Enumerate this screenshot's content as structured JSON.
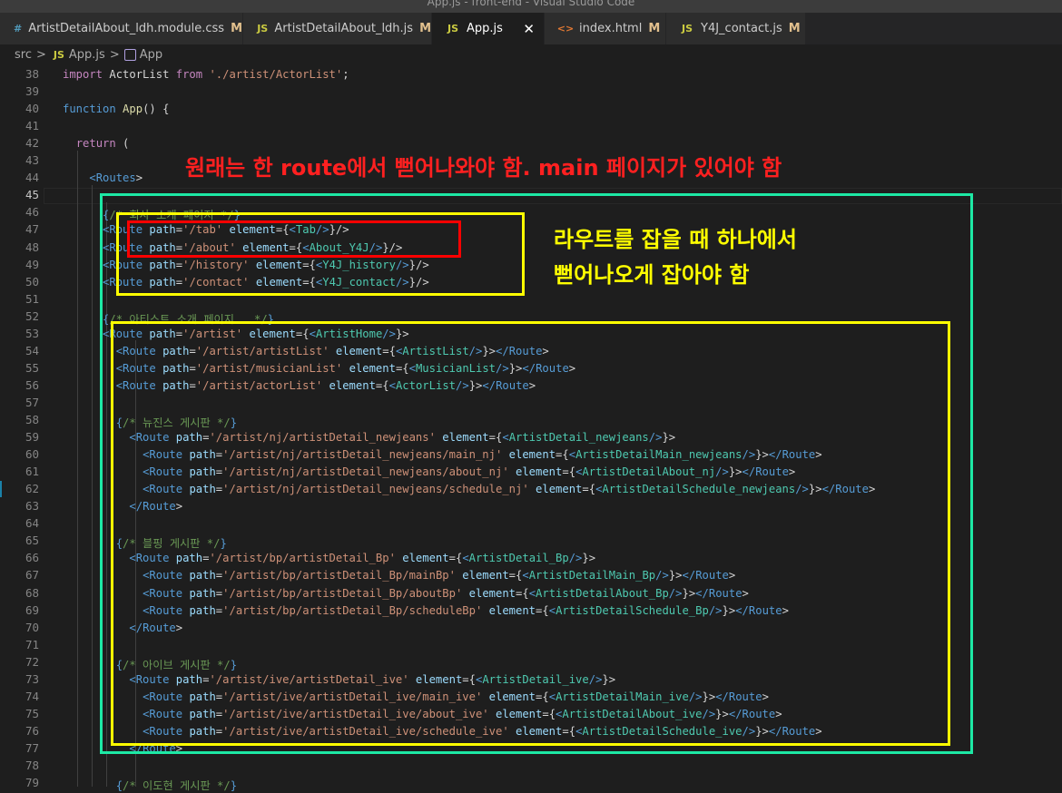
{
  "window": {
    "title": "App.js - front-end - Visual Studio Code"
  },
  "tabs": [
    {
      "icon": "#",
      "label": "ArtistDetailAbout_ldh.module.css",
      "status": "M",
      "active": false
    },
    {
      "icon": "JS",
      "label": "ArtistDetailAbout_ldh.js",
      "status": "M",
      "active": false
    },
    {
      "icon": "JS",
      "label": "App.js",
      "status": "",
      "active": true,
      "close": "✕"
    },
    {
      "icon": "<>",
      "label": "index.html",
      "status": "M",
      "active": false
    },
    {
      "icon": "JS",
      "label": "Y4J_contact.js",
      "status": "M",
      "active": false
    }
  ],
  "breadcrumb": {
    "folder": "src",
    "sep": ">",
    "file_icon": "JS",
    "file": "App.js",
    "symbol": "App"
  },
  "code_lines": [
    {
      "n": "38",
      "text": "import ActorList from './artist/ActorList';"
    },
    {
      "n": "39",
      "text": ""
    },
    {
      "n": "40",
      "text": "function App() {"
    },
    {
      "n": "41",
      "text": ""
    },
    {
      "n": "42",
      "text": "  return ("
    },
    {
      "n": "43",
      "text": ""
    },
    {
      "n": "44",
      "text": "    <Routes>"
    },
    {
      "n": "45",
      "text": ""
    },
    {
      "n": "46",
      "text": "      {/* 회사 소개 페이지 */}"
    },
    {
      "n": "47",
      "text": "      <Route path='/tab' element={<Tab/>}/>"
    },
    {
      "n": "48",
      "text": "      <Route path='/about' element={<About_Y4J/>}/>"
    },
    {
      "n": "49",
      "text": "      <Route path='/history' element={<Y4J_history/>}/>"
    },
    {
      "n": "50",
      "text": "      <Route path='/contact' element={<Y4J_contact/>}/>"
    },
    {
      "n": "51",
      "text": ""
    },
    {
      "n": "52",
      "text": "      {/* 아티스트 소개 페이지   */}"
    },
    {
      "n": "53",
      "text": "      <Route path='/artist' element={<ArtistHome/>}>"
    },
    {
      "n": "54",
      "text": "        <Route path='/artist/artistList' element={<ArtistList/>}></Route>"
    },
    {
      "n": "55",
      "text": "        <Route path='/artist/musicianList' element={<MusicianList/>}></Route>"
    },
    {
      "n": "56",
      "text": "        <Route path='/artist/actorList' element={<ActorList/>}></Route>"
    },
    {
      "n": "57",
      "text": ""
    },
    {
      "n": "58",
      "text": "        {/* 뉴진스 게시판 */}"
    },
    {
      "n": "59",
      "text": "          <Route path='/artist/nj/artistDetail_newjeans' element={<ArtistDetail_newjeans/>}>"
    },
    {
      "n": "60",
      "text": "            <Route path='/artist/nj/artistDetail_newjeans/main_nj' element={<ArtistDetailMain_newjeans/>}></Route>"
    },
    {
      "n": "61",
      "text": "            <Route path='/artist/nj/artistDetail_newjeans/about_nj' element={<ArtistDetailAbout_nj/>}></Route>"
    },
    {
      "n": "62",
      "text": "            <Route path='/artist/nj/artistDetail_newjeans/schedule_nj' element={<ArtistDetailSchedule_newjeans/>}></Route>"
    },
    {
      "n": "63",
      "text": "          </Route>"
    },
    {
      "n": "64",
      "text": ""
    },
    {
      "n": "65",
      "text": "        {/* 블핑 게시판 */}"
    },
    {
      "n": "66",
      "text": "          <Route path='/artist/bp/artistDetail_Bp' element={<ArtistDetail_Bp/>}>"
    },
    {
      "n": "67",
      "text": "            <Route path='/artist/bp/artistDetail_Bp/mainBp' element={<ArtistDetailMain_Bp/>}></Route>"
    },
    {
      "n": "68",
      "text": "            <Route path='/artist/bp/artistDetail_Bp/aboutBp' element={<ArtistDetailAbout_Bp/>}></Route>"
    },
    {
      "n": "69",
      "text": "            <Route path='/artist/bp/artistDetail_Bp/scheduleBp' element={<ArtistDetailSchedule_Bp/>}></Route>"
    },
    {
      "n": "70",
      "text": "          </Route>"
    },
    {
      "n": "71",
      "text": ""
    },
    {
      "n": "72",
      "text": "        {/* 아이브 게시판 */}"
    },
    {
      "n": "73",
      "text": "          <Route path='/artist/ive/artistDetail_ive' element={<ArtistDetail_ive/>}>"
    },
    {
      "n": "74",
      "text": "            <Route path='/artist/ive/artistDetail_ive/main_ive' element={<ArtistDetailMain_ive/>}></Route>"
    },
    {
      "n": "75",
      "text": "            <Route path='/artist/ive/artistDetail_ive/about_ive' element={<ArtistDetailAbout_ive/>}></Route>"
    },
    {
      "n": "76",
      "text": "            <Route path='/artist/ive/artistDetail_ive/schedule_ive' element={<ArtistDetailSchedule_ive/>}></Route>"
    },
    {
      "n": "77",
      "text": "          </Route>"
    },
    {
      "n": "78",
      "text": ""
    },
    {
      "n": "79",
      "text": "        {/* 이도현 게시판 */}"
    }
  ],
  "current_line": "45",
  "annotations": {
    "top_note": "원래는 한 route에서 뻗어나와야 함. main 페이지가 있어야 함",
    "side_note_line1": "라우트를 잡을 때 하나에서",
    "side_note_line2": "뻗어나오게 잡아야 함"
  },
  "colors": {
    "top_note": "#ff2020",
    "side_note": "#ffff00",
    "green_box": "#1de9a5",
    "yellow_box": "#ffff00",
    "red_box": "#ff0000"
  }
}
